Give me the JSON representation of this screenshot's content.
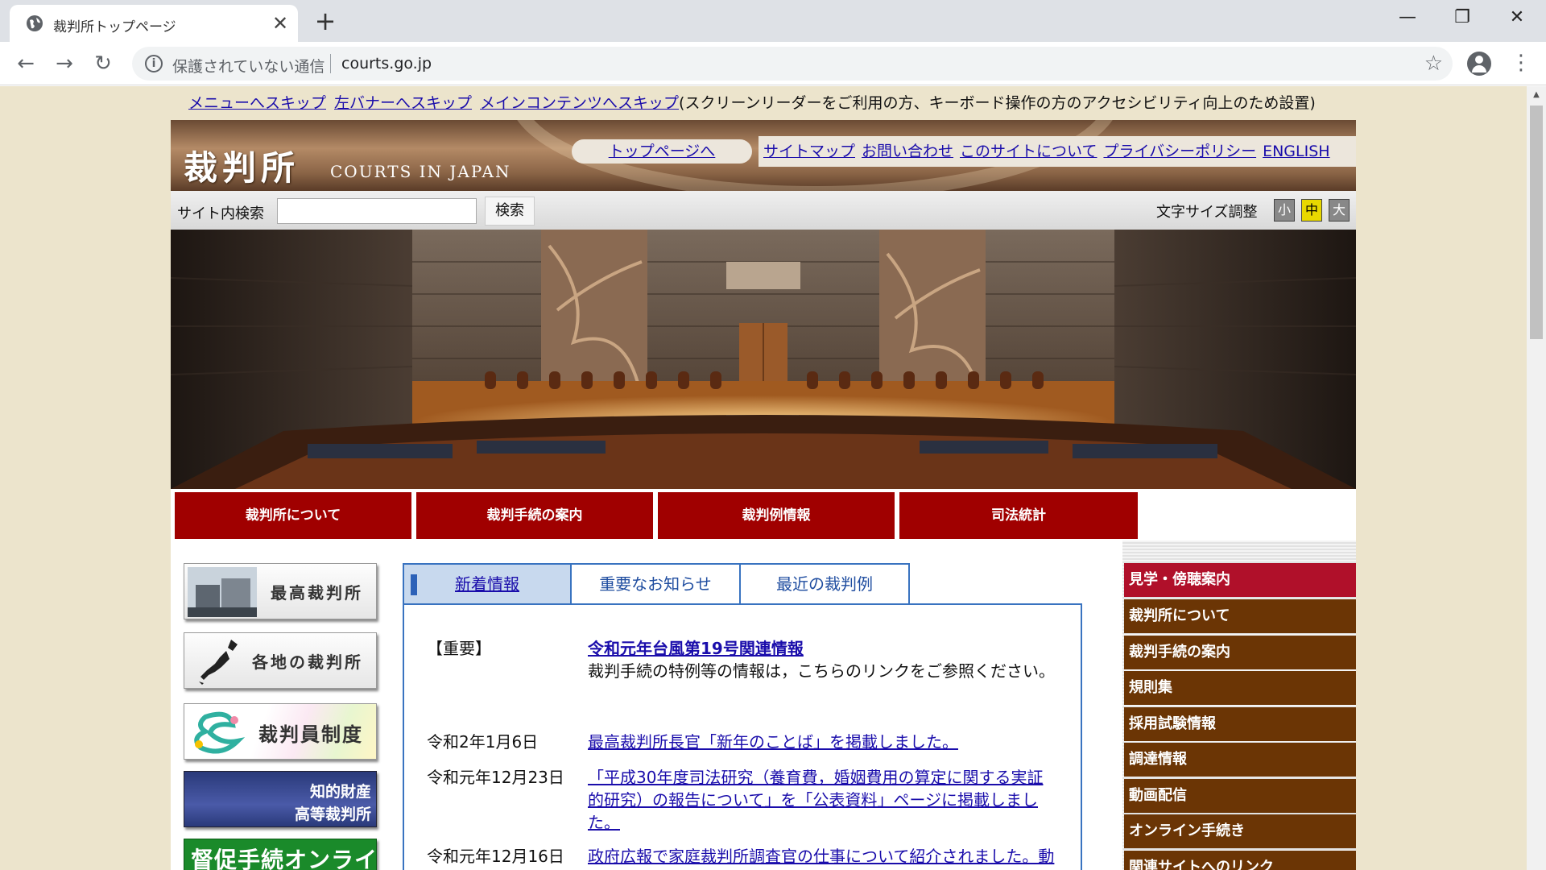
{
  "browser": {
    "tab_title": "裁判所トップページ",
    "tab_close": "✕",
    "new_tab": "+",
    "window_controls": [
      "—",
      "❐",
      "✕"
    ],
    "security_text": "保護されていない通信",
    "url": "courts.go.jp",
    "icons": {
      "back": "←",
      "forward": "→",
      "reload": "↻",
      "info": "i",
      "star": "☆",
      "menu": "⋮"
    }
  },
  "page": {
    "skip_links": [
      "メニューへスキップ",
      "左バナーへスキップ",
      "メインコンテンツへスキップ"
    ],
    "skip_note": "(スクリーンリーダーをご利用の方、キーボード操作の方のアクセシビリティ向上のため設置)",
    "logo_kanji": "裁判所",
    "logo_en": "COURTS IN JAPAN",
    "top_page_link": "トップページへ",
    "header_links": [
      "サイトマップ",
      "お問い合わせ",
      "このサイトについて",
      "プライバシーポリシー",
      "ENGLISH"
    ],
    "search_label": "サイト内検索",
    "search_value": "",
    "search_button": "検索",
    "font_size_label": "文字サイズ調整",
    "font_sizes": [
      "小",
      "中",
      "大"
    ],
    "font_size_selected": "中",
    "nav": [
      "裁判所について",
      "裁判手続の案内",
      "裁判例情報",
      "司法統計"
    ],
    "banners": {
      "supreme": "最高裁判所",
      "local": "各地の裁判所",
      "saibanin": "裁判員制度",
      "ip_line1": "知的財産",
      "ip_line2": "高等裁判所",
      "online": "督促手続オンライン"
    },
    "tabs": [
      "新着情報",
      "重要なお知らせ",
      "最近の裁判例"
    ],
    "news": [
      {
        "date": "【重要】",
        "link": "令和元年台風第19号関連情報",
        "text": "裁判手続の特例等の情報は，こちらのリンクをご参照ください。"
      },
      {
        "date": "令和2年1月6日",
        "link": "最高裁判所長官「新年のことば」を掲載しました。"
      },
      {
        "date": "令和元年12月23日",
        "link": "「平成30年度司法研究（養育費，婚姻費用の算定に関する実証的研究）の報告について」を「公表資料」ページに掲載しました。"
      },
      {
        "date": "令和元年12月16日",
        "link": "政府広報で家庭裁判所調査官の仕事について紹介されました。動画でご覧いただけます。"
      }
    ],
    "right_menu": [
      "見学・傍聴案内",
      "裁判所について",
      "裁判手続の案内",
      "規則集",
      "採用試験情報",
      "調達情報",
      "動画配信",
      "オンライン手続き",
      "関連サイトへのリンク"
    ],
    "colors": {
      "nav_red": "#a00000",
      "right_menu_brown": "#6b3505",
      "right_menu_highlight": "#b0102a",
      "page_bg": "#ece4cc",
      "link": "#1a0dab"
    }
  }
}
